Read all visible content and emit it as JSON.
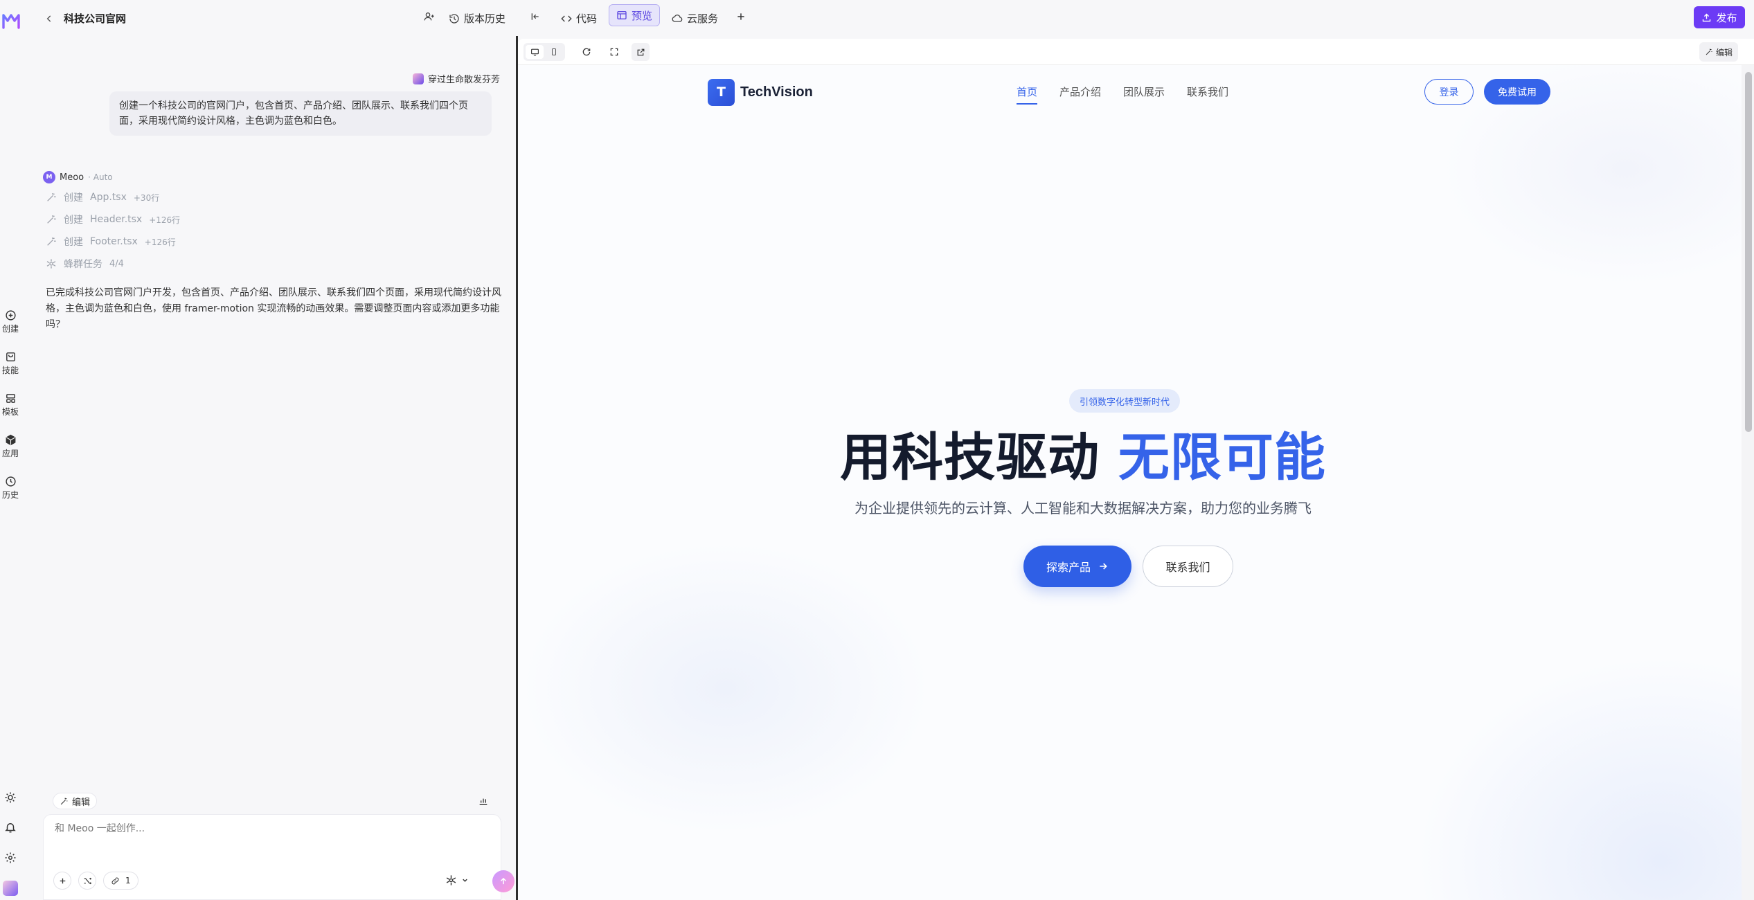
{
  "app": {
    "logo_text": "M",
    "project_title": "科技公司官网"
  },
  "topbar": {
    "history_label": "版本历史",
    "code_label": "代码",
    "preview_label": "预览",
    "cloud_label": "云服务",
    "publish_label": "发布"
  },
  "rail": {
    "items": [
      {
        "label": "创建",
        "icon": "plus-circle-icon"
      },
      {
        "label": "技能",
        "icon": "bag-icon"
      },
      {
        "label": "模板",
        "icon": "grid-icon"
      },
      {
        "label": "应用",
        "icon": "cube-icon"
      },
      {
        "label": "历史",
        "icon": "clock-icon"
      }
    ]
  },
  "chat": {
    "user_name": "穿过生命散发芬芳",
    "user_message": "创建一个科技公司的官网门户，包含首页、产品介绍、团队展示、联系我们四个页面，采用现代简约设计风格，主色调为蓝色和白色。",
    "assistant_name": "Meoo",
    "assistant_mode": "· Auto",
    "actions": [
      {
        "verb": "创建",
        "file": "App.tsx",
        "count": "+30行"
      },
      {
        "verb": "创建",
        "file": "Header.tsx",
        "count": "+126行"
      },
      {
        "verb": "创建",
        "file": "Footer.tsx",
        "count": "+126行"
      }
    ],
    "swarm_label": "蜂群任务",
    "swarm_count": "4/4",
    "reply": "已完成科技公司官网门户开发，包含首页、产品介绍、团队展示、联系我们四个页面，采用现代简约设计风格，主色调为蓝色和白色，使用 framer-motion 实现流畅的动画效果。需要调整页面内容或添加更多功能吗？",
    "edit_chip": "编辑",
    "input_placeholder": "和 Meoo 一起创作...",
    "attach_count": "1"
  },
  "preview_toolbar": {
    "edit_label": "编辑"
  },
  "site": {
    "brand_initial": "T",
    "brand_name": "TechVision",
    "nav": [
      "首页",
      "产品介绍",
      "团队展示",
      "联系我们"
    ],
    "login_label": "登录",
    "trial_label": "免费试用",
    "badge": "引领数字化转型新时代",
    "headline_dark": "用科技驱动",
    "headline_blue": "无限可能",
    "subtitle": "为企业提供领先的云计算、人工智能和大数据解决方案，助力您的业务腾飞",
    "primary_cta": "探索产品",
    "secondary_cta": "联系我们"
  },
  "colors": {
    "accent": "#3563e9",
    "brand_purple": "#6c3bf5",
    "headline_dark": "#141b2d",
    "preview_active_bg": "#e6e4fb"
  }
}
